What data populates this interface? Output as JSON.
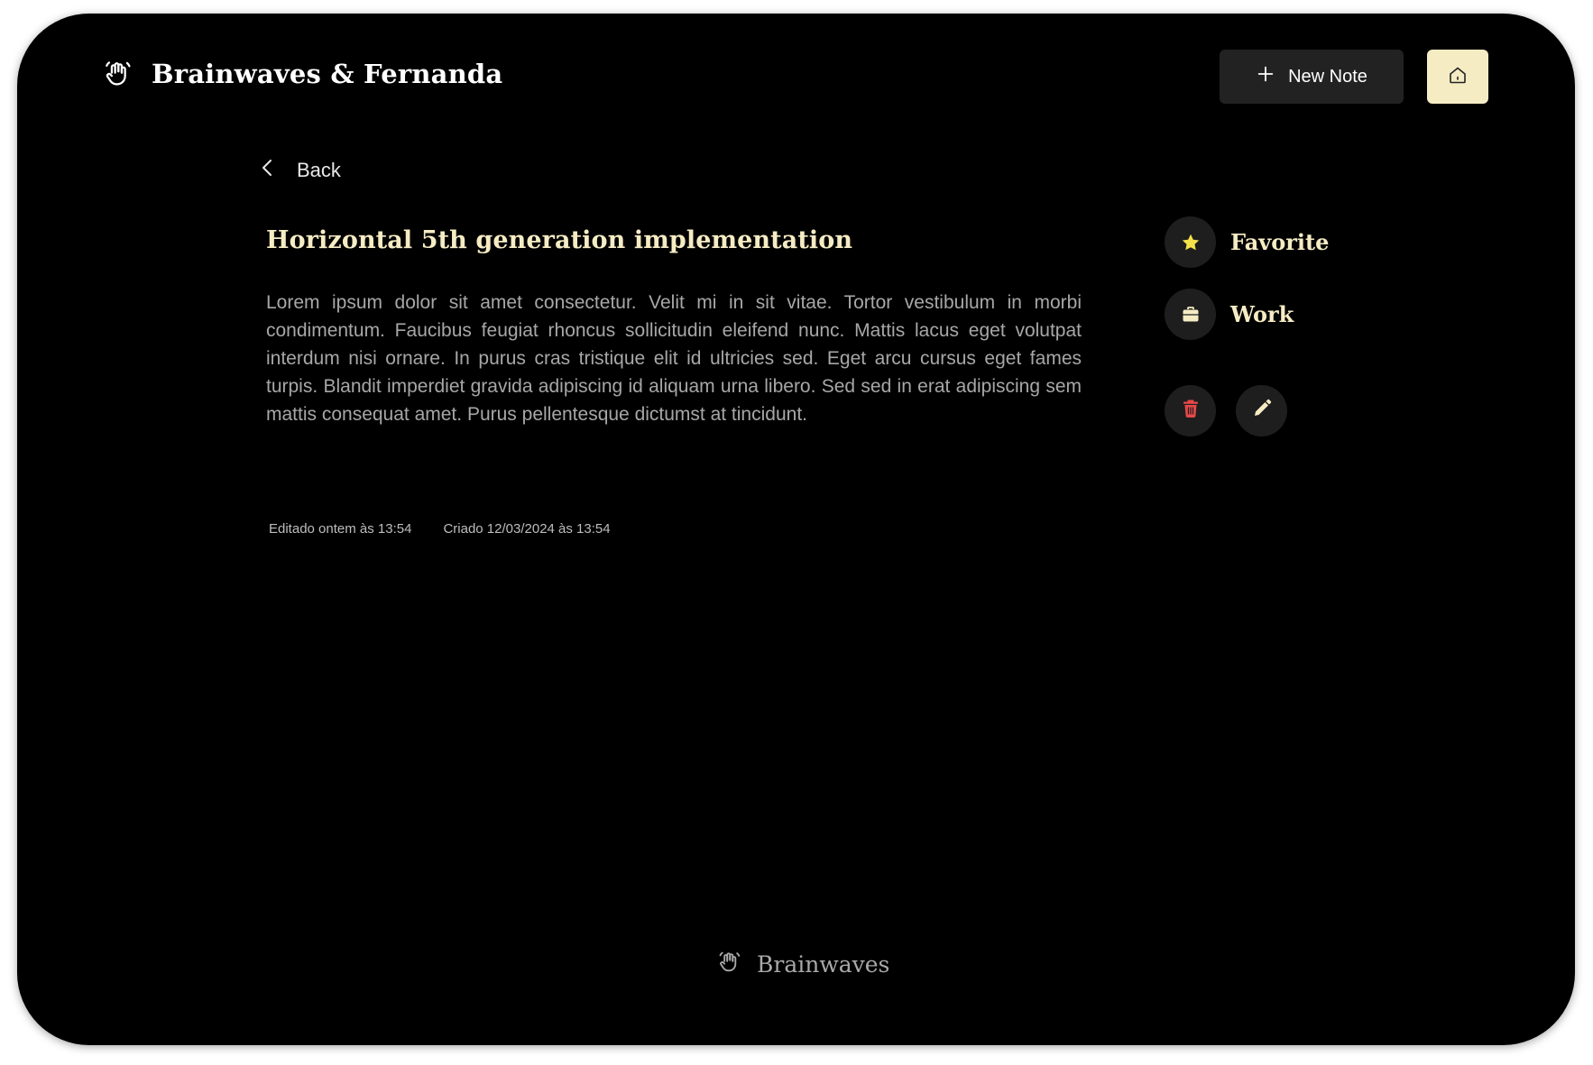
{
  "header": {
    "brand_icon": "hand-wave-icon",
    "brand_title": "Brainwaves & Fernanda",
    "new_note_label": "New Note",
    "new_note_icon": "plus-icon",
    "home_icon": "home-icon"
  },
  "nav": {
    "back_label": "Back",
    "back_icon": "chevron-left-icon"
  },
  "note": {
    "title": "Horizontal 5th generation implementation",
    "body": "Lorem ipsum dolor sit amet consectetur. Velit mi in sit vitae. Tortor vestibulum in morbi condimentum. Faucibus feugiat rhoncus sollicitudin eleifend nunc. Mattis lacus eget volutpat interdum nisi ornare. In purus cras tristique elit id ultricies sed. Eget arcu cursus eget fames turpis. Blandit imperdiet gravida adipiscing id aliquam urna libero. Sed sed in erat adipiscing sem mattis consequat amet. Purus pellentesque dictumst at tincidunt.",
    "edited": "Editado ontem às 13:54",
    "created": "Criado 12/03/2024 às 13:54"
  },
  "sidebar": {
    "favorite_label": "Favorite",
    "favorite_icon": "star-icon",
    "category_label": "Work",
    "category_icon": "briefcase-icon",
    "delete_icon": "trash-icon",
    "edit_icon": "pencil-icon"
  },
  "footer": {
    "brand_icon": "hand-wave-icon",
    "brand_text": "Brainwaves"
  },
  "colors": {
    "background": "#000000",
    "accent": "#f6ecc4",
    "surface": "#1e1e1e",
    "star": "#f5e14a",
    "danger": "#e54848"
  }
}
